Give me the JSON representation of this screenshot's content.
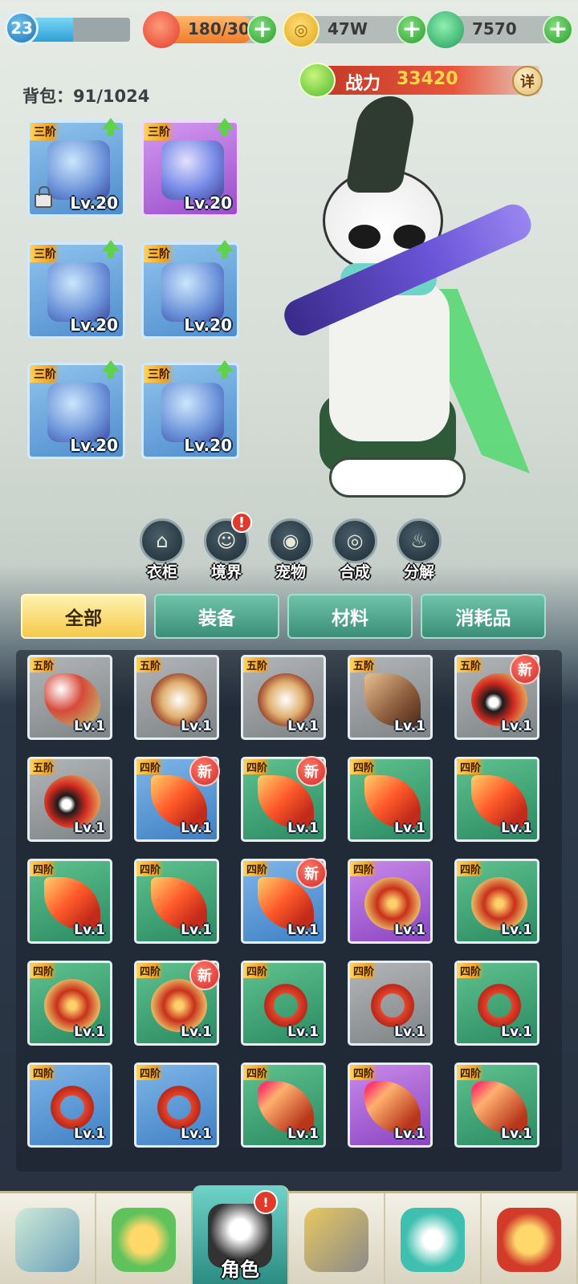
{
  "player": {
    "level": "23",
    "xp_fraction": 0.46
  },
  "resources": {
    "stamina": "180/30",
    "coins": "47W",
    "jade": "7570"
  },
  "power": {
    "label": "战力",
    "value": "33420",
    "detail_button": "详"
  },
  "bag": {
    "label": "背包：",
    "count": "91/1024"
  },
  "equipment": [
    {
      "tier": "三阶",
      "level": "Lv.20",
      "rarity": "blue",
      "upgrade": true,
      "locked": true,
      "icon": "sword-icon"
    },
    {
      "tier": "三阶",
      "level": "Lv.20",
      "rarity": "purple",
      "upgrade": true,
      "locked": false,
      "icon": "helmet-icon"
    },
    {
      "tier": "三阶",
      "level": "Lv.20",
      "rarity": "blue",
      "upgrade": true,
      "locked": false,
      "icon": "armor-icon"
    },
    {
      "tier": "三阶",
      "level": "Lv.20",
      "rarity": "blue",
      "upgrade": true,
      "locked": false,
      "icon": "ring-icon"
    },
    {
      "tier": "三阶",
      "level": "Lv.20",
      "rarity": "blue",
      "upgrade": true,
      "locked": false,
      "icon": "bracer-icon"
    },
    {
      "tier": "三阶",
      "level": "Lv.20",
      "rarity": "blue",
      "upgrade": true,
      "locked": false,
      "icon": "boots-icon"
    }
  ],
  "functions": [
    {
      "label": "衣柜",
      "icon": "wardrobe-icon",
      "alert": false
    },
    {
      "label": "境界",
      "icon": "realm-icon",
      "alert": true
    },
    {
      "label": "宠物",
      "icon": "pet-icon",
      "alert": false
    },
    {
      "label": "合成",
      "icon": "synthesis-icon",
      "alert": false
    },
    {
      "label": "分解",
      "icon": "decompose-icon",
      "alert": false
    }
  ],
  "alert_mark": "!",
  "tabs": [
    "全部",
    "装备",
    "材料",
    "消耗品"
  ],
  "items": [
    {
      "tier": "五阶",
      "level": "Lv.1",
      "rarity": "gray",
      "art": "dagger",
      "new": false
    },
    {
      "tier": "五阶",
      "level": "Lv.1",
      "rarity": "gray",
      "art": "shield",
      "new": false
    },
    {
      "tier": "五阶",
      "level": "Lv.1",
      "rarity": "gray",
      "art": "shield",
      "new": false
    },
    {
      "tier": "五阶",
      "level": "Lv.1",
      "rarity": "gray",
      "art": "fan",
      "new": false
    },
    {
      "tier": "五阶",
      "level": "Lv.1",
      "rarity": "gray",
      "art": "gourd",
      "new": true
    },
    {
      "tier": "五阶",
      "level": "Lv.1",
      "rarity": "gray",
      "art": "gourd",
      "new": false
    },
    {
      "tier": "四阶",
      "level": "Lv.1",
      "rarity": "blue",
      "art": "flame",
      "new": true
    },
    {
      "tier": "四阶",
      "level": "Lv.1",
      "rarity": "teal",
      "art": "flame",
      "new": true
    },
    {
      "tier": "四阶",
      "level": "Lv.1",
      "rarity": "teal",
      "art": "flame",
      "new": false
    },
    {
      "tier": "四阶",
      "level": "Lv.1",
      "rarity": "teal",
      "art": "flame",
      "new": false
    },
    {
      "tier": "四阶",
      "level": "Lv.1",
      "rarity": "teal",
      "art": "flame",
      "new": false
    },
    {
      "tier": "四阶",
      "level": "Lv.1",
      "rarity": "teal",
      "art": "flame",
      "new": false
    },
    {
      "tier": "四阶",
      "level": "Lv.1",
      "rarity": "blue",
      "art": "flame",
      "new": true
    },
    {
      "tier": "四阶",
      "level": "Lv.1",
      "rarity": "purple",
      "art": "bow",
      "new": false
    },
    {
      "tier": "四阶",
      "level": "Lv.1",
      "rarity": "teal",
      "art": "bow",
      "new": false
    },
    {
      "tier": "四阶",
      "level": "Lv.1",
      "rarity": "teal",
      "art": "bow",
      "new": false
    },
    {
      "tier": "四阶",
      "level": "Lv.1",
      "rarity": "teal",
      "art": "bow",
      "new": true
    },
    {
      "tier": "四阶",
      "level": "Lv.1",
      "rarity": "teal",
      "art": "ring",
      "new": false
    },
    {
      "tier": "四阶",
      "level": "Lv.1",
      "rarity": "gray",
      "art": "ring",
      "new": false
    },
    {
      "tier": "四阶",
      "level": "Lv.1",
      "rarity": "teal",
      "art": "ring",
      "new": false
    },
    {
      "tier": "四阶",
      "level": "Lv.1",
      "rarity": "blue",
      "art": "ring",
      "new": false
    },
    {
      "tier": "四阶",
      "level": "Lv.1",
      "rarity": "blue",
      "art": "ring",
      "new": false
    },
    {
      "tier": "四阶",
      "level": "Lv.1",
      "rarity": "teal",
      "art": "wand",
      "new": false
    },
    {
      "tier": "四阶",
      "level": "Lv.1",
      "rarity": "purple",
      "art": "wand",
      "new": false
    },
    {
      "tier": "四阶",
      "level": "Lv.1",
      "rarity": "teal",
      "art": "wand",
      "new": false
    }
  ],
  "new_badge": "新",
  "nav": [
    {
      "icon": "map-icon",
      "label": ""
    },
    {
      "icon": "frog-coin-icon",
      "label": ""
    },
    {
      "icon": "character-icon",
      "label": "角色",
      "active": true,
      "alert": true
    },
    {
      "icon": "crossed-swords-icon",
      "label": ""
    },
    {
      "icon": "gourd-icon",
      "label": ""
    },
    {
      "icon": "paw-shield-icon",
      "label": ""
    }
  ]
}
